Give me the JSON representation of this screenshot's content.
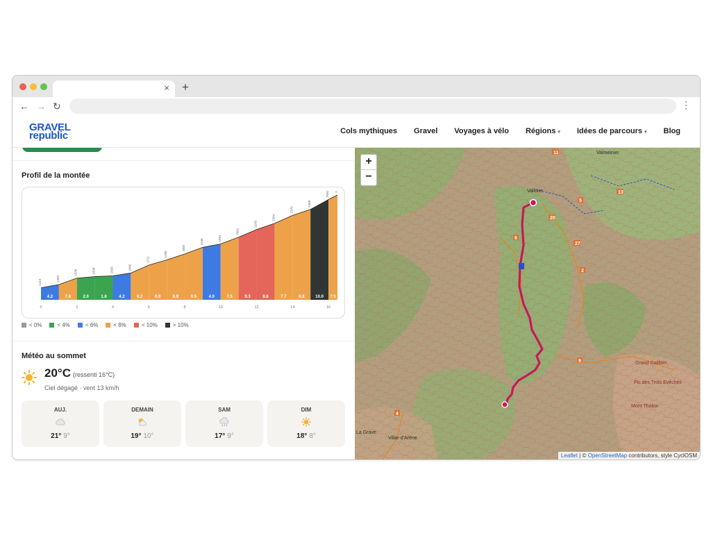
{
  "browser": {
    "tab_close": "×",
    "new_tab": "+",
    "back": "←",
    "forward": "→",
    "reload": "↻",
    "menu": "⋮"
  },
  "site": {
    "logo_line1": "GRAVEL",
    "logo_line2": "republic",
    "nav": [
      {
        "label": "Cols mythiques",
        "dropdown": false
      },
      {
        "label": "Gravel",
        "dropdown": false
      },
      {
        "label": "Voyages à vélo",
        "dropdown": false
      },
      {
        "label": "Régions",
        "dropdown": true
      },
      {
        "label": "Idées de parcours",
        "dropdown": true
      },
      {
        "label": "Blog",
        "dropdown": false
      }
    ]
  },
  "profile": {
    "title": "Profil de la montée",
    "legend": [
      {
        "label": "< 0%",
        "color": "#9a9a9a"
      },
      {
        "label": "< 4%",
        "color": "#3ca34f"
      },
      {
        "label": "< 6%",
        "color": "#3d7be3"
      },
      {
        "label": "< 8%",
        "color": "#eda24a"
      },
      {
        "label": "< 10%",
        "color": "#e4665a"
      },
      {
        "label": "> 10%",
        "color": "#2f3633"
      }
    ]
  },
  "chart_data": {
    "type": "area",
    "xlabel": "",
    "ylabel": "",
    "xlim": [
      0,
      16.5
    ],
    "x_ticks": [
      "0",
      "2",
      "4",
      "6",
      "8",
      "10",
      "12",
      "14",
      "16"
    ],
    "segments": [
      {
        "from": 0,
        "to": 1,
        "grade": 4.2,
        "color": "#3d7be3"
      },
      {
        "from": 1,
        "to": 2,
        "grade": 7.6,
        "color": "#eda24a"
      },
      {
        "from": 2,
        "to": 3,
        "grade": 2.0,
        "color": "#3ca34f"
      },
      {
        "from": 3,
        "to": 4,
        "grade": 1.8,
        "color": "#3ca34f"
      },
      {
        "from": 4,
        "to": 5,
        "grade": 4.2,
        "color": "#3d7be3"
      },
      {
        "from": 5,
        "to": 6,
        "grade": 6.2,
        "color": "#eda24a"
      },
      {
        "from": 6,
        "to": 7,
        "grade": 6.9,
        "color": "#eda24a"
      },
      {
        "from": 7,
        "to": 8,
        "grade": 6.9,
        "color": "#eda24a"
      },
      {
        "from": 8,
        "to": 9,
        "grade": 6.5,
        "color": "#eda24a"
      },
      {
        "from": 9,
        "to": 10,
        "grade": 4.0,
        "color": "#3d7be3"
      },
      {
        "from": 10,
        "to": 11,
        "grade": 7.5,
        "color": "#eda24a"
      },
      {
        "from": 11,
        "to": 12,
        "grade": 9.3,
        "color": "#e4665a"
      },
      {
        "from": 12,
        "to": 13,
        "grade": 8.6,
        "color": "#e4665a"
      },
      {
        "from": 13,
        "to": 14,
        "grade": 7.7,
        "color": "#eda24a"
      },
      {
        "from": 14,
        "to": 15,
        "grade": 6.8,
        "color": "#eda24a"
      },
      {
        "from": 15,
        "to": 16,
        "grade": 10.0,
        "color": "#2f3633"
      },
      {
        "from": 16,
        "to": 16.5,
        "grade": 7.5,
        "color": "#eda24a"
      }
    ],
    "altitudes": [
      {
        "x": 0,
        "label": "1410"
      },
      {
        "x": 1,
        "label": "1453"
      },
      {
        "x": 2,
        "label": "1538"
      },
      {
        "x": 3,
        "label": "1558"
      },
      {
        "x": 4,
        "label": "1569"
      },
      {
        "x": 5,
        "label": "1605"
      },
      {
        "x": 6,
        "label": "1711"
      },
      {
        "x": 7,
        "label": "1780"
      },
      {
        "x": 8,
        "label": "1858"
      },
      {
        "x": 9,
        "label": "1946"
      },
      {
        "x": 10,
        "label": "1991"
      },
      {
        "x": 11,
        "label": "2081"
      },
      {
        "x": 12,
        "label": "2183"
      },
      {
        "x": 13,
        "label": "2264"
      },
      {
        "x": 14,
        "label": "2370"
      },
      {
        "x": 15,
        "label": "2450"
      },
      {
        "x": 16,
        "label": "2581"
      },
      {
        "x": 16.5,
        "label": "2"
      }
    ],
    "profile_elevations": [
      1410,
      1453,
      1538,
      1558,
      1569,
      1605,
      1711,
      1780,
      1858,
      1946,
      1991,
      2081,
      2183,
      2264,
      2370,
      2450,
      2581,
      2642
    ],
    "ylim": [
      1250,
      2650
    ]
  },
  "weather": {
    "title": "Météo au sommet",
    "current_temp": "20°C",
    "feels_like": "(ressenti 16°C)",
    "condition": "Ciel dégagé · vent 13 km/h",
    "days": [
      {
        "name": "AUJ.",
        "icon": "cloud-icon",
        "high": "21°",
        "low": "9°"
      },
      {
        "name": "DEMAIN",
        "icon": "sun-cloud-icon",
        "high": "19°",
        "low": "10°"
      },
      {
        "name": "SAM",
        "icon": "rain-cloud-icon",
        "high": "17°",
        "low": "9°"
      },
      {
        "name": "DIM",
        "icon": "sun-icon",
        "high": "18°",
        "low": "8°"
      }
    ]
  },
  "map": {
    "zoom_in": "+",
    "zoom_out": "−",
    "attribution_leaflet": "Leaflet",
    "attribution_sep": " | © ",
    "attribution_osm": "OpenStreetMap",
    "attribution_rest": " contributors, style CyclOSM",
    "place_labels": [
      "Valloire",
      "Valmeinier",
      "La Grave",
      "Villar-d'Arène",
      "Grand Galibier",
      "Pic des Trois Evêchés",
      "Mont Thabor"
    ],
    "road_numbers": [
      "11",
      "13",
      "5",
      "20",
      "27",
      "2",
      "6",
      "9",
      "4"
    ],
    "route_color": "#c8185a"
  }
}
